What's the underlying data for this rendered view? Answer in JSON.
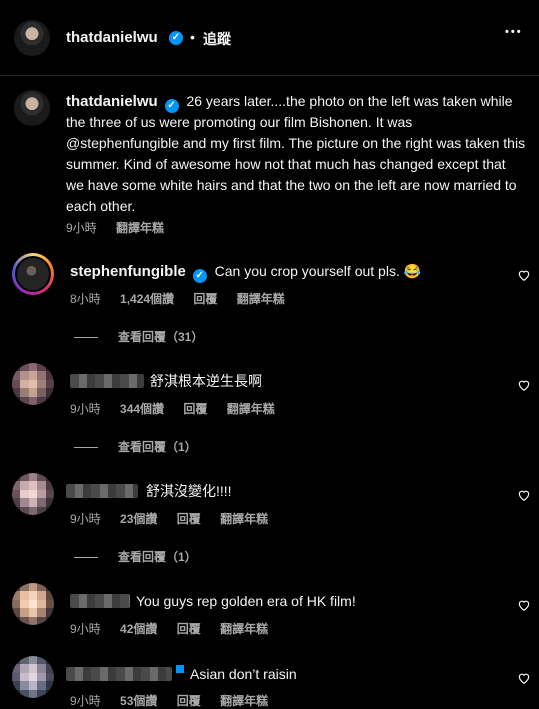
{
  "header": {
    "username": "thatdanielwu",
    "dot": "•",
    "follow_label": "追蹤",
    "more": "•••"
  },
  "caption": {
    "username": "thatdanielwu",
    "text": "26 years later....the photo on the left was taken while the three of us were promoting our film Bishonen. It was @stephenfungible and my first film. The picture on the right was taken this summer. Kind of awesome how not that much has changed except that we have some white hairs and that the two on the left are now married to each other.",
    "time": "9小時",
    "translate": "翻譯年糕"
  },
  "comments": [
    {
      "username": "stephenfungible",
      "text": "Can you crop yourself out pls. 😂",
      "time": "8小時",
      "likes": "1,424個讚",
      "reply": "回覆",
      "translate": "翻譯年糕",
      "view_replies": "查看回覆（31）"
    },
    {
      "text": "舒淇根本逆生長啊",
      "time": "9小時",
      "likes": "344個讚",
      "reply": "回覆",
      "translate": "翻譯年糕",
      "view_replies": "查看回覆（1）"
    },
    {
      "text": "舒淇沒變化!!!!",
      "time": "9小時",
      "likes": "23個讚",
      "reply": "回覆",
      "translate": "翻譯年糕",
      "view_replies": "查看回覆（1）"
    },
    {
      "text": "You guys rep golden era of HK film!",
      "time": "9小時",
      "likes": "42個讚",
      "reply": "回覆",
      "translate": "翻譯年糕"
    },
    {
      "text": "Asian don’t raisin",
      "time": "9小時",
      "likes": "53個讚",
      "reply": "回覆",
      "translate": "翻譯年糕"
    }
  ],
  "colors": {
    "background": "#000000",
    "verified": "#0095f6",
    "secondary_text": "#a8a8a8"
  }
}
